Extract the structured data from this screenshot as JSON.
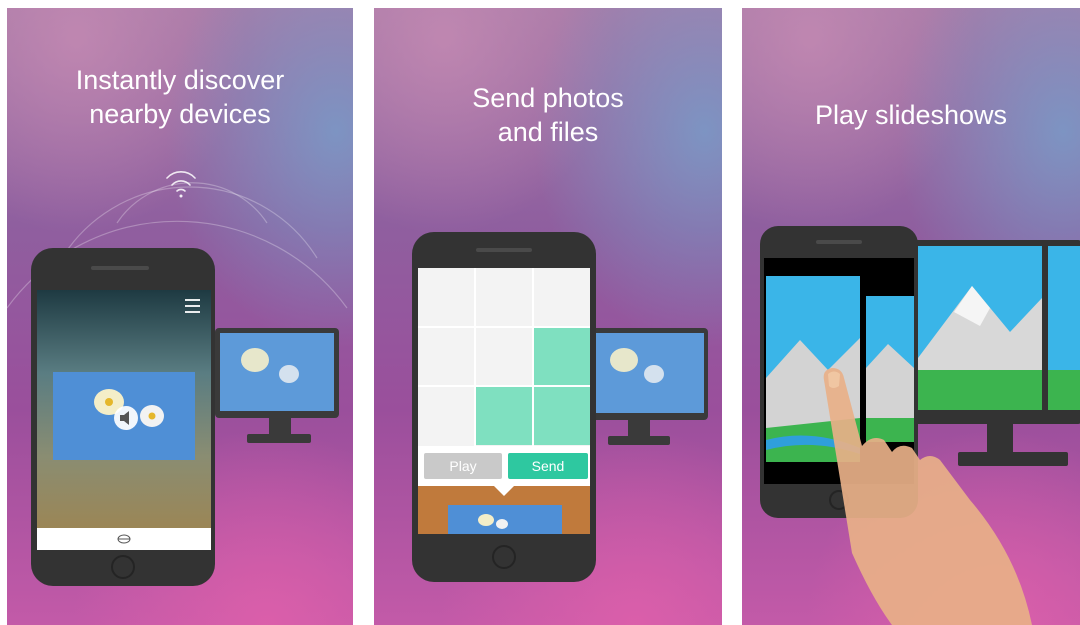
{
  "panels": [
    {
      "headline_line1": "Instantly discover",
      "headline_line2": "nearby devices"
    },
    {
      "headline_line1": "Send photos",
      "headline_line2": "and files",
      "play_label": "Play",
      "send_label": "Send"
    },
    {
      "headline_line1": "Play slideshows"
    }
  ],
  "colors": {
    "accent_send": "#2ec8a0",
    "tile": "#7fe0c0",
    "phone_body": "#333333",
    "gradient_top": "#a77aa7",
    "gradient_bottom": "#c35aa8"
  },
  "icons": [
    "wifi-signal-icon",
    "hamburger-menu-icon",
    "volume-icon",
    "shelf-icon",
    "home-button-icon",
    "finger-hand-icon"
  ]
}
